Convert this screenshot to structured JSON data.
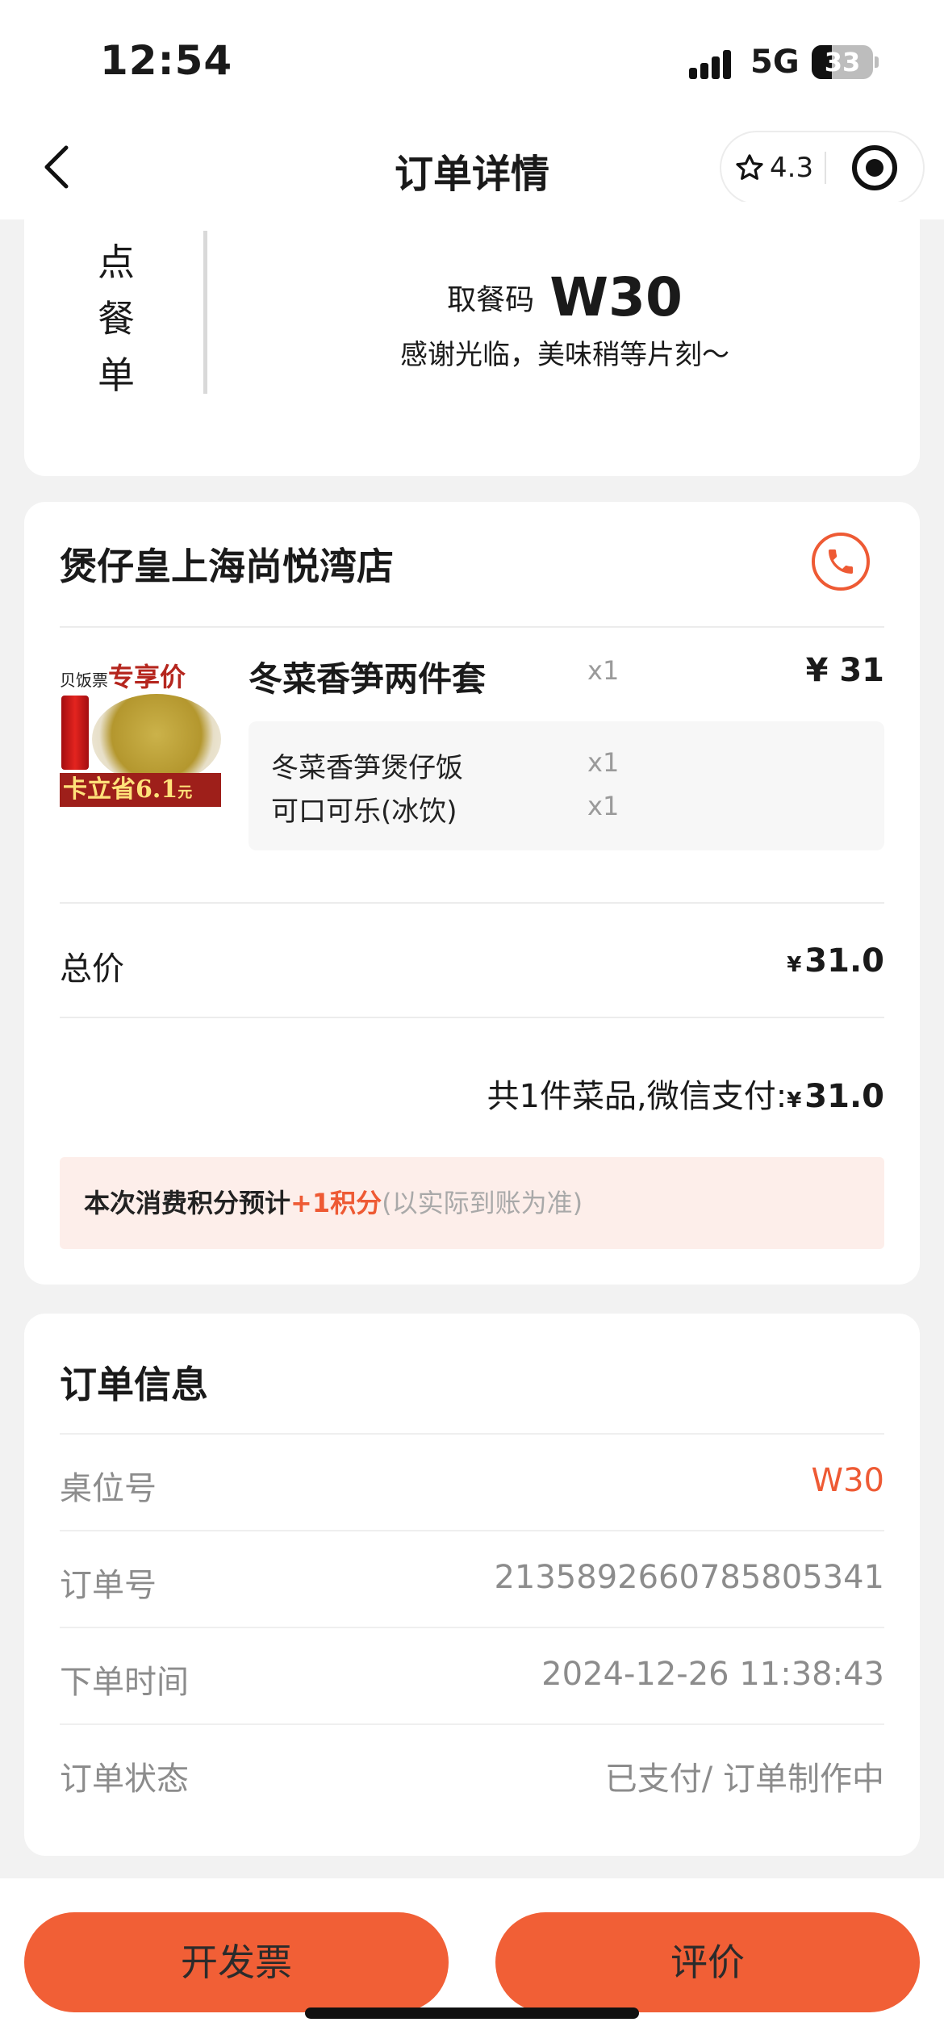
{
  "status_bar": {
    "time": "12:54",
    "network": "5G",
    "battery": "33",
    "battery_level": 0.33
  },
  "header": {
    "title": "订单详情",
    "back_icon": "chevron-left-icon",
    "rating": "4.3",
    "rating_icon": "star-outline-icon",
    "record_icon": "record-icon"
  },
  "pickup": {
    "vertical_label": [
      "点",
      "餐",
      "单"
    ],
    "code_label": "取餐码",
    "code": "W30",
    "thanks": "感谢光临，美味稍等片刻～"
  },
  "store": {
    "name": "煲仔皇上海尚悦湾店",
    "phone_icon": "phone-icon",
    "accent_color": "#ee5a34"
  },
  "item": {
    "image_top_left": "贝饭票",
    "image_top_right": "专享价",
    "image_banner": "卡立省6.1",
    "image_banner_unit": "元",
    "name": "冬菜香笋两件套",
    "qty": "x1",
    "price": "¥ 31",
    "components": [
      {
        "name": "冬菜香笋煲仔饭",
        "qty": "x1"
      },
      {
        "name": "可口可乐(冰饮)",
        "qty": "x1"
      }
    ]
  },
  "summary": {
    "total_label": "总价",
    "currency": "¥",
    "total_value": "31.0",
    "paid_prefix": "共1件菜品,微信支付:",
    "paid_value": "31.0"
  },
  "points": {
    "prefix": "本次消费积分预计",
    "value": "+1积分",
    "note": "(以实际到账为准)"
  },
  "order_info": {
    "title": "订单信息",
    "rows": [
      {
        "label": "桌位号",
        "value": "W30"
      },
      {
        "label": "订单号",
        "value": "2135892660785805341"
      },
      {
        "label": "下单时间",
        "value": "2024-12-26 11:38:43"
      },
      {
        "label": "订单状态",
        "value": "已支付/ 订单制作中"
      }
    ]
  },
  "actions": {
    "invoice": "开发票",
    "review": "评价"
  }
}
